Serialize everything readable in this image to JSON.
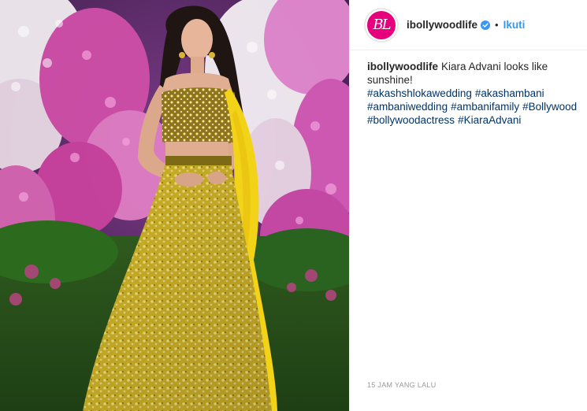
{
  "post": {
    "username": "ibollywoodlife",
    "avatar_initials": "BL",
    "follow_label": "Ikuti",
    "separator": "•",
    "caption_text": "Kiara Advani looks like sunshine!",
    "hashtags": [
      "#akashshlokawedding",
      "#akashambani",
      "#ambaniwedding",
      "#ambanifamily",
      "#Bollywood",
      "#bollywoodactress",
      "#KiaraAdvani"
    ],
    "timestamp": "15 JAM YANG LALU"
  },
  "colors": {
    "accent_link": "#3897f0",
    "hashtag": "#003569",
    "avatar_bg": "#e6007e",
    "outfit_yellow": "#f2d11e"
  },
  "icons": {
    "verified": "verified-badge-icon"
  }
}
